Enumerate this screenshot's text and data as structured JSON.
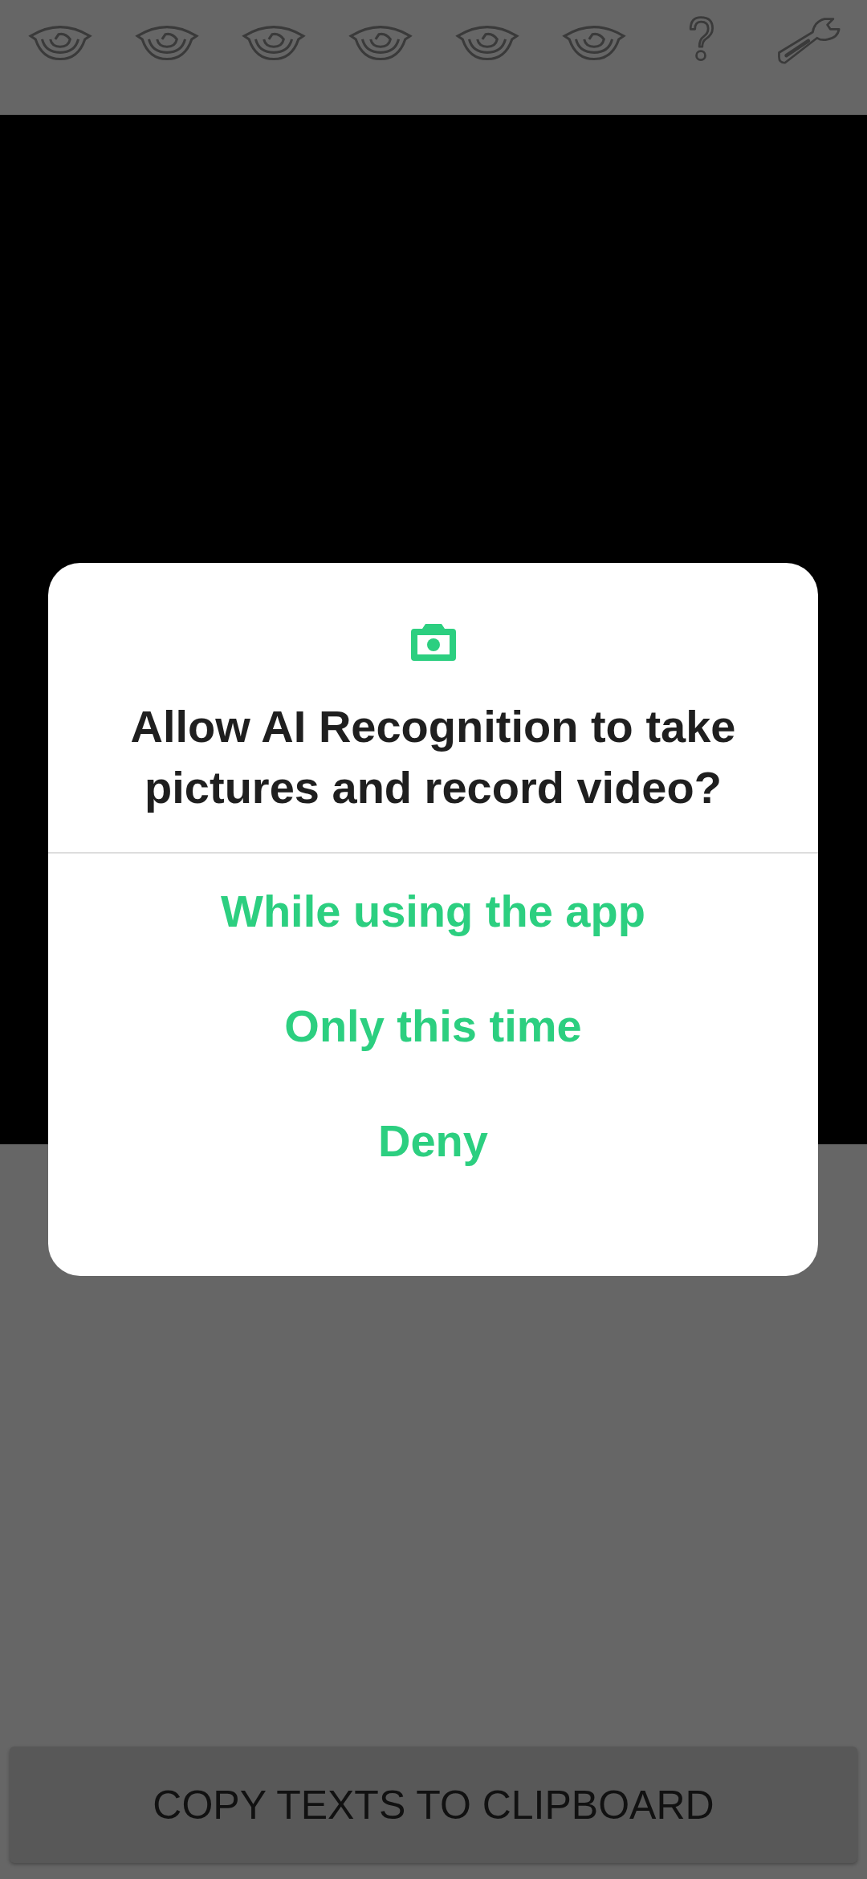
{
  "permission_dialog": {
    "title": "Allow AI Recognition to take pictures and record video?",
    "options": [
      "While using the app",
      "Only this time",
      "Deny"
    ]
  },
  "copy_button": {
    "label": "COPY TEXTS TO CLIPBOARD"
  }
}
